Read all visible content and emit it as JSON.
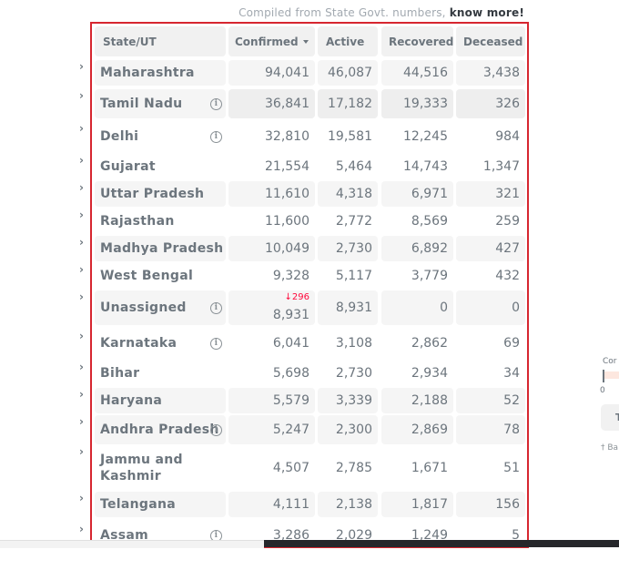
{
  "compiled": {
    "text": "Compiled from State Govt. numbers,",
    "link": "know more!"
  },
  "table": {
    "headers": {
      "state": "State/UT",
      "confirmed": "Confirmed",
      "active": "Active",
      "recovered": "Recovered",
      "deceased": "Deceased"
    },
    "rows": [
      {
        "state": "Maharashtra",
        "confirmed": "94,041",
        "active": "46,087",
        "recovered": "44,516",
        "deceased": "3,438",
        "info": false
      },
      {
        "state": "Tamil Nadu",
        "confirmed": "36,841",
        "active": "17,182",
        "recovered": "19,333",
        "deceased": "326",
        "info": true
      },
      {
        "state": "Delhi",
        "confirmed": "32,810",
        "active": "19,581",
        "recovered": "12,245",
        "deceased": "984",
        "info": true
      },
      {
        "state": "Gujarat",
        "confirmed": "21,554",
        "active": "5,464",
        "recovered": "14,743",
        "deceased": "1,347",
        "info": false
      },
      {
        "state": "Uttar Pradesh",
        "confirmed": "11,610",
        "active": "4,318",
        "recovered": "6,971",
        "deceased": "321",
        "info": false
      },
      {
        "state": "Rajasthan",
        "confirmed": "11,600",
        "active": "2,772",
        "recovered": "8,569",
        "deceased": "259",
        "info": false
      },
      {
        "state": "Madhya Pradesh",
        "confirmed": "10,049",
        "active": "2,730",
        "recovered": "6,892",
        "deceased": "427",
        "info": false
      },
      {
        "state": "West Bengal",
        "confirmed": "9,328",
        "active": "5,117",
        "recovered": "3,779",
        "deceased": "432",
        "info": false
      },
      {
        "state": "Unassigned",
        "confirmed": "8,931",
        "confirmed_delta": "↓296",
        "active": "8,931",
        "recovered": "0",
        "deceased": "0",
        "info": true
      },
      {
        "state": "Karnataka",
        "confirmed": "6,041",
        "active": "3,108",
        "recovered": "2,862",
        "deceased": "69",
        "info": true
      },
      {
        "state": "Bihar",
        "confirmed": "5,698",
        "active": "2,730",
        "recovered": "2,934",
        "deceased": "34",
        "info": false
      },
      {
        "state": "Haryana",
        "confirmed": "5,579",
        "active": "3,339",
        "recovered": "2,188",
        "deceased": "52",
        "info": false
      },
      {
        "state": "Andhra Pradesh",
        "confirmed": "5,247",
        "active": "2,300",
        "recovered": "2,869",
        "deceased": "78",
        "info": true
      },
      {
        "state": "Jammu and Kashmir",
        "state_line1": "Jammu and",
        "state_line2": "Kashmir",
        "confirmed": "4,507",
        "active": "2,785",
        "recovered": "1,671",
        "deceased": "51",
        "info": false
      },
      {
        "state": "Telangana",
        "confirmed": "4,111",
        "active": "2,138",
        "recovered": "1,817",
        "deceased": "156",
        "info": false
      },
      {
        "state": "Assam",
        "confirmed": "3,286",
        "active": "2,029",
        "recovered": "1,249",
        "deceased": "5",
        "info": true
      }
    ]
  },
  "side_panel": {
    "label": "Cor",
    "zero": "0",
    "button": "T",
    "note": "† Ba"
  },
  "icons": {
    "expand": "chevron-right-icon",
    "info": "info-icon",
    "sort": "caret-down-icon"
  },
  "colors": {
    "frame": "#d6262f",
    "delta": "#ff073a",
    "text": "#6c757d"
  }
}
